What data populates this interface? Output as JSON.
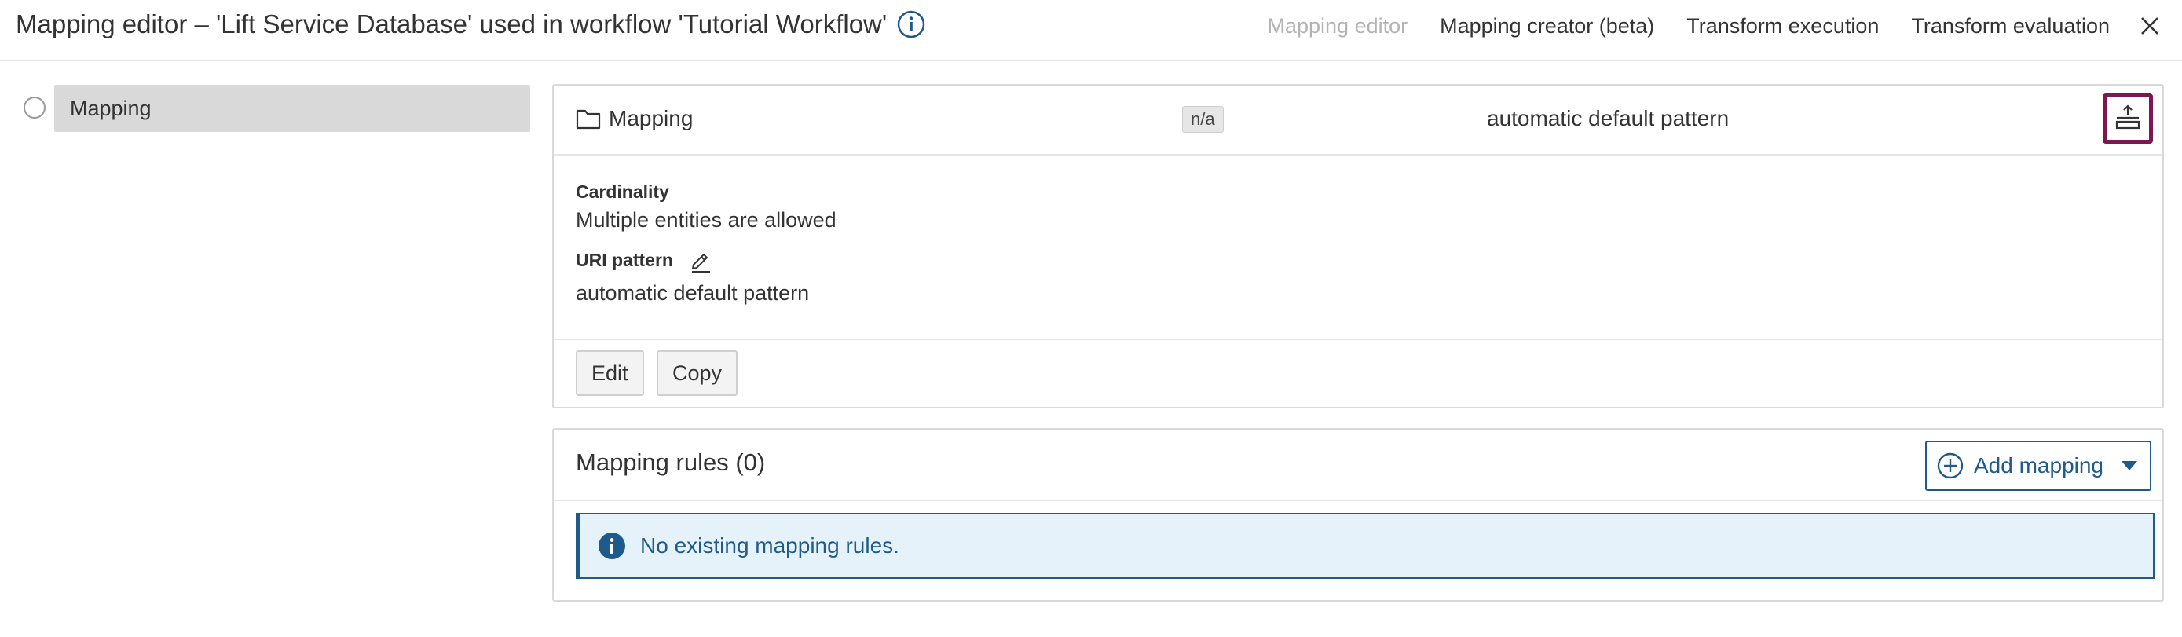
{
  "header": {
    "title": "Mapping editor – 'Lift Service Database' used in workflow 'Tutorial Workflow'",
    "info_icon": "info-circle-icon",
    "nav": [
      {
        "label": "Mapping editor",
        "state": "disabled"
      },
      {
        "label": "Mapping creator (beta)",
        "state": "enabled"
      },
      {
        "label": "Transform execution",
        "state": "enabled"
      },
      {
        "label": "Transform evaluation",
        "state": "enabled"
      }
    ],
    "close_icon": "close-icon"
  },
  "sidebar": {
    "items": [
      {
        "label": "Mapping",
        "selected": true
      }
    ]
  },
  "main": {
    "card": {
      "icon": "folder-icon",
      "title": "Mapping",
      "badge": "n/a",
      "pattern_summary": "automatic default pattern",
      "collapse_icon": "collapse-up-icon",
      "cardinality_label": "Cardinality",
      "cardinality_value": "Multiple entities are allowed",
      "uri_pattern_label": "URI pattern",
      "uri_pattern_value": "automatic default pattern",
      "edit_label": "Edit",
      "copy_label": "Copy"
    },
    "rules": {
      "title": "Mapping rules (0)",
      "add_label": "Add mapping",
      "empty_message": "No existing mapping rules."
    }
  },
  "colors": {
    "accent": "#1e5a8a",
    "highlight_border": "#7d1651",
    "info_bg": "#e6f2fa",
    "sidebar_selected_bg": "#d9d9d9"
  }
}
